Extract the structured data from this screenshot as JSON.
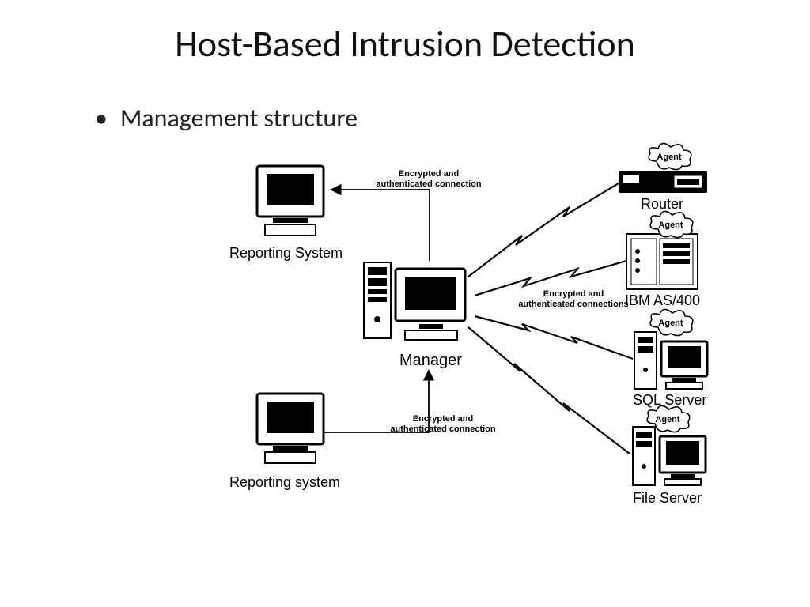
{
  "title": "Host-Based Intrusion Detection",
  "bullet": "Management structure",
  "nodes": {
    "manager": "Manager",
    "reporting1": "Reporting System",
    "reporting2": "Reporting system",
    "router": "Router",
    "as400": "IBM AS/400",
    "sqlserver": "SQL Server",
    "fileserver": "File Server"
  },
  "agent_badges": [
    "Agent",
    "Agent",
    "Agent",
    "Agent"
  ],
  "edge_labels": {
    "top": "Encrypted and\nauthenticated connection",
    "bottom": "Encrypted and\nauthenticated connection",
    "right": "Encrypted and\nauthenticated connections"
  }
}
